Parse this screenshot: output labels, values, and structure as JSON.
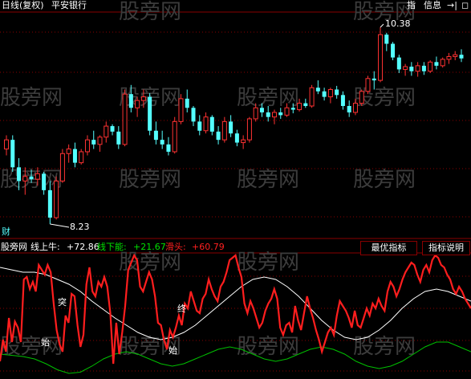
{
  "header": {
    "title": "日线(复权)",
    "stock_name": "平安银行",
    "tab_index": "指",
    "tab_info": "信息",
    "nav_arrow": "→|",
    "nav_window": "◻"
  },
  "watermark": "股旁网",
  "top_chart": {
    "high_label": "10.38",
    "low_label": "8.23",
    "cai_label": "财",
    "colors": {
      "up": "#ff3232",
      "down": "#54ffff",
      "grid": "#8a0000"
    },
    "candles": [
      [
        9.05,
        9.2,
        8.98,
        9.15
      ],
      [
        9.15,
        9.2,
        8.8,
        8.85
      ],
      [
        8.85,
        8.95,
        8.6,
        8.7
      ],
      [
        8.7,
        8.85,
        8.55,
        8.75
      ],
      [
        8.75,
        8.82,
        8.68,
        8.72
      ],
      [
        8.72,
        8.85,
        8.65,
        8.78
      ],
      [
        8.78,
        8.8,
        8.55,
        8.6
      ],
      [
        8.6,
        8.7,
        8.23,
        8.3
      ],
      [
        8.3,
        8.75,
        8.28,
        8.7
      ],
      [
        8.7,
        9.05,
        8.68,
        9.0
      ],
      [
        9.0,
        9.1,
        8.9,
        9.05
      ],
      [
        9.05,
        9.12,
        8.85,
        8.9
      ],
      [
        8.9,
        9.05,
        8.88,
        9.02
      ],
      [
        9.02,
        9.2,
        8.98,
        9.15
      ],
      [
        9.15,
        9.25,
        9.05,
        9.1
      ],
      [
        9.1,
        9.2,
        9.02,
        9.18
      ],
      [
        9.18,
        9.35,
        9.12,
        9.3
      ],
      [
        9.3,
        9.32,
        9.2,
        9.24
      ],
      [
        9.24,
        9.3,
        9.05,
        9.1
      ],
      [
        9.1,
        9.7,
        9.08,
        9.65
      ],
      [
        9.65,
        9.75,
        9.45,
        9.5
      ],
      [
        9.5,
        9.62,
        9.4,
        9.58
      ],
      [
        9.58,
        9.7,
        9.5,
        9.62
      ],
      [
        9.62,
        9.66,
        9.2,
        9.25
      ],
      [
        9.25,
        9.35,
        9.1,
        9.15
      ],
      [
        9.15,
        9.25,
        9.05,
        9.1
      ],
      [
        9.1,
        9.18,
        8.98,
        9.02
      ],
      [
        9.02,
        9.4,
        9.0,
        9.35
      ],
      [
        9.35,
        9.65,
        9.32,
        9.6
      ],
      [
        9.6,
        9.7,
        9.45,
        9.5
      ],
      [
        9.5,
        9.52,
        9.3,
        9.35
      ],
      [
        9.35,
        9.42,
        9.2,
        9.25
      ],
      [
        9.25,
        9.45,
        9.22,
        9.4
      ],
      [
        9.4,
        9.42,
        9.2,
        9.24
      ],
      [
        9.24,
        9.3,
        9.1,
        9.15
      ],
      [
        9.15,
        9.4,
        9.12,
        9.35
      ],
      [
        9.35,
        9.42,
        9.18,
        9.22
      ],
      [
        9.22,
        9.26,
        9.08,
        9.12
      ],
      [
        9.12,
        9.2,
        9.05,
        9.15
      ],
      [
        9.15,
        9.4,
        9.12,
        9.38
      ],
      [
        9.38,
        9.55,
        9.35,
        9.5
      ],
      [
        9.5,
        9.55,
        9.4,
        9.45
      ],
      [
        9.45,
        9.52,
        9.35,
        9.4
      ],
      [
        9.4,
        9.48,
        9.32,
        9.45
      ],
      [
        9.45,
        9.5,
        9.38,
        9.42
      ],
      [
        9.42,
        9.55,
        9.4,
        9.5
      ],
      [
        9.5,
        9.55,
        9.44,
        9.48
      ],
      [
        9.48,
        9.6,
        9.46,
        9.55
      ],
      [
        9.55,
        9.6,
        9.5,
        9.52
      ],
      [
        9.52,
        9.75,
        9.5,
        9.72
      ],
      [
        9.72,
        9.8,
        9.65,
        9.68
      ],
      [
        9.68,
        9.72,
        9.58,
        9.62
      ],
      [
        9.62,
        9.72,
        9.55,
        9.7
      ],
      [
        9.7,
        9.74,
        9.6,
        9.64
      ],
      [
        9.64,
        9.68,
        9.48,
        9.52
      ],
      [
        9.52,
        9.58,
        9.4,
        9.45
      ],
      [
        9.45,
        9.6,
        9.42,
        9.55
      ],
      [
        9.55,
        9.7,
        9.52,
        9.68
      ],
      [
        9.68,
        9.85,
        9.65,
        9.82
      ],
      [
        9.82,
        9.9,
        9.7,
        9.8
      ],
      [
        9.8,
        10.38,
        9.78,
        10.3
      ],
      [
        10.3,
        10.32,
        10.12,
        10.2
      ],
      [
        10.2,
        10.22,
        10.02,
        10.05
      ],
      [
        10.05,
        10.08,
        9.88,
        9.92
      ],
      [
        9.92,
        9.98,
        9.85,
        9.95
      ],
      [
        9.95,
        10.0,
        9.85,
        9.9
      ],
      [
        9.9,
        10.0,
        9.84,
        9.96
      ],
      [
        9.96,
        10.0,
        9.86,
        9.9
      ],
      [
        9.9,
        10.02,
        9.88,
        10.0
      ],
      [
        10.0,
        10.06,
        9.92,
        9.96
      ],
      [
        9.96,
        10.05,
        9.94,
        10.03
      ],
      [
        10.03,
        10.1,
        9.98,
        10.06
      ],
      [
        10.06,
        10.12,
        10.02,
        10.08
      ],
      [
        10.08,
        10.14,
        10.0,
        10.04
      ]
    ]
  },
  "indicator": {
    "site": "股旁网",
    "name": "线上牛:",
    "v1": "+72.86",
    "label2": "线下能:",
    "v2": "+21.67",
    "label3": "滑头:",
    "v3": "+60.79",
    "best_button": "最优指标",
    "explain_button": "指标说明",
    "mark_tu": "突",
    "mark_zhong": "终",
    "mark_shi1": "始",
    "mark_shi2": "始",
    "colors": {
      "upper": "#ffffff",
      "lower": "#00c000",
      "main": "#ff1e1e"
    },
    "upper_line": [
      90,
      88,
      86,
      86,
      84,
      80,
      76,
      70,
      62,
      55,
      48,
      42,
      36,
      32,
      30,
      32,
      36,
      42,
      50,
      58,
      66,
      74,
      80,
      82,
      80,
      74,
      66,
      56,
      46,
      38,
      32,
      30,
      32,
      38,
      46,
      56,
      64,
      70,
      72,
      70,
      66,
      62
    ],
    "lower_line": [
      18,
      17,
      16,
      14,
      10,
      5,
      2,
      3,
      8,
      14,
      18,
      20,
      18,
      14,
      10,
      8,
      10,
      14,
      18,
      22,
      24,
      22,
      18,
      14,
      12,
      14,
      18,
      22,
      24,
      22,
      18,
      12,
      8,
      6,
      8,
      12,
      18,
      24,
      28,
      28,
      24,
      20
    ],
    "main_line": [
      12,
      30,
      20,
      48,
      28,
      45,
      40,
      28,
      80,
      82,
      72,
      78,
      70,
      92,
      88,
      84,
      92,
      86,
      60,
      38,
      26,
      20,
      50,
      44,
      68,
      66,
      42,
      24,
      34,
      76,
      90,
      70,
      66,
      78,
      74,
      82,
      74,
      52,
      10,
      44,
      18,
      36,
      58,
      88,
      94,
      100,
      96,
      74,
      70,
      78,
      86,
      80,
      66,
      44,
      42,
      30,
      22,
      38,
      32,
      40,
      50,
      42,
      60,
      56,
      70,
      62,
      54,
      52,
      64,
      68,
      80,
      72,
      66,
      62,
      74,
      78,
      86,
      96,
      98,
      100,
      90,
      82,
      60,
      52,
      62,
      56,
      48,
      40,
      44,
      54,
      60,
      64,
      72,
      64,
      40,
      34,
      42,
      44,
      36,
      58,
      46,
      38,
      52,
      66,
      56,
      48,
      38,
      30,
      20,
      28,
      36,
      40,
      34,
      50,
      62,
      58,
      54,
      48,
      40,
      54,
      42,
      40,
      48,
      56,
      50,
      60,
      56,
      64,
      58,
      54,
      70,
      78,
      74,
      66,
      72,
      80,
      86,
      90,
      94,
      92,
      84,
      78,
      88,
      92,
      86,
      96,
      100,
      98,
      92,
      90,
      84,
      80,
      72,
      68,
      74,
      70,
      64,
      60,
      56
    ]
  }
}
